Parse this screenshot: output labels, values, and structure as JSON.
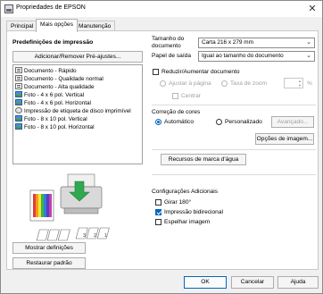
{
  "window": {
    "title": "Propriedades de EPSON",
    "close_glyph": "✕"
  },
  "tabs": [
    {
      "label": "Principal"
    },
    {
      "label": "Mais opções"
    },
    {
      "label": "Manutenção"
    }
  ],
  "left": {
    "section_title": "Predefinições de impressão",
    "add_remove_button": "Adicionar/Remover Pré-ajustes...",
    "presets": [
      {
        "label": "Documento - Rápido",
        "icon": "document-icon"
      },
      {
        "label": "Documento - Qualidade normal",
        "icon": "document-icon"
      },
      {
        "label": "Documento - Alta qualidade",
        "icon": "document-icon"
      },
      {
        "label": "Foto - 4 x 6 pol. Vertical",
        "icon": "photo-icon"
      },
      {
        "label": "Foto - 4 x 6 pol. Horizontal",
        "icon": "photo-icon"
      },
      {
        "label": "Impressão de etiqueta de disco imprimível",
        "icon": "disc-icon"
      },
      {
        "label": "Foto - 8 x 10 pol. Vertical",
        "icon": "photo-icon"
      },
      {
        "label": "Foto - 8 x 10 pol. Horizontal",
        "icon": "photo-icon"
      }
    ],
    "show_settings_button": "Mostrar definições",
    "restore_defaults_button": "Restaurar padrão"
  },
  "right": {
    "doc_size_label": "Tamanho do documento",
    "doc_size_value": "Carta 216 x 279 mm",
    "output_paper_label": "Papel de saída",
    "output_paper_value": "Igual ao tamanho do documento",
    "reduce_enlarge_label": "Reduzir/Aumentar documento",
    "reduce_enlarge_checked": false,
    "fit_page_label": "Ajustar à página",
    "zoom_rate_label": "Taxa de zoom",
    "percent_label": "%",
    "center_label": "Centrar",
    "color_correction_title": "Correção de cores",
    "auto_label": "Automático",
    "custom_label": "Personalizado",
    "advanced_button": "Avançado...",
    "image_options_button": "Opções de imagem...",
    "watermark_button": "Recursos de marca d'água",
    "additional_title": "Configurações Adicionais",
    "rotate_label": "Girar 180°",
    "rotate_checked": false,
    "bidirectional_label": "Impressão bidirecional",
    "bidirectional_checked": true,
    "mirror_label": "Espelhar imagem",
    "mirror_checked": false
  },
  "footer": {
    "ok_button": "OK",
    "cancel_button": "Cancelar",
    "help_button": "Ajuda"
  },
  "colors": {
    "accent": "#0067c0",
    "border": "#adadad"
  }
}
